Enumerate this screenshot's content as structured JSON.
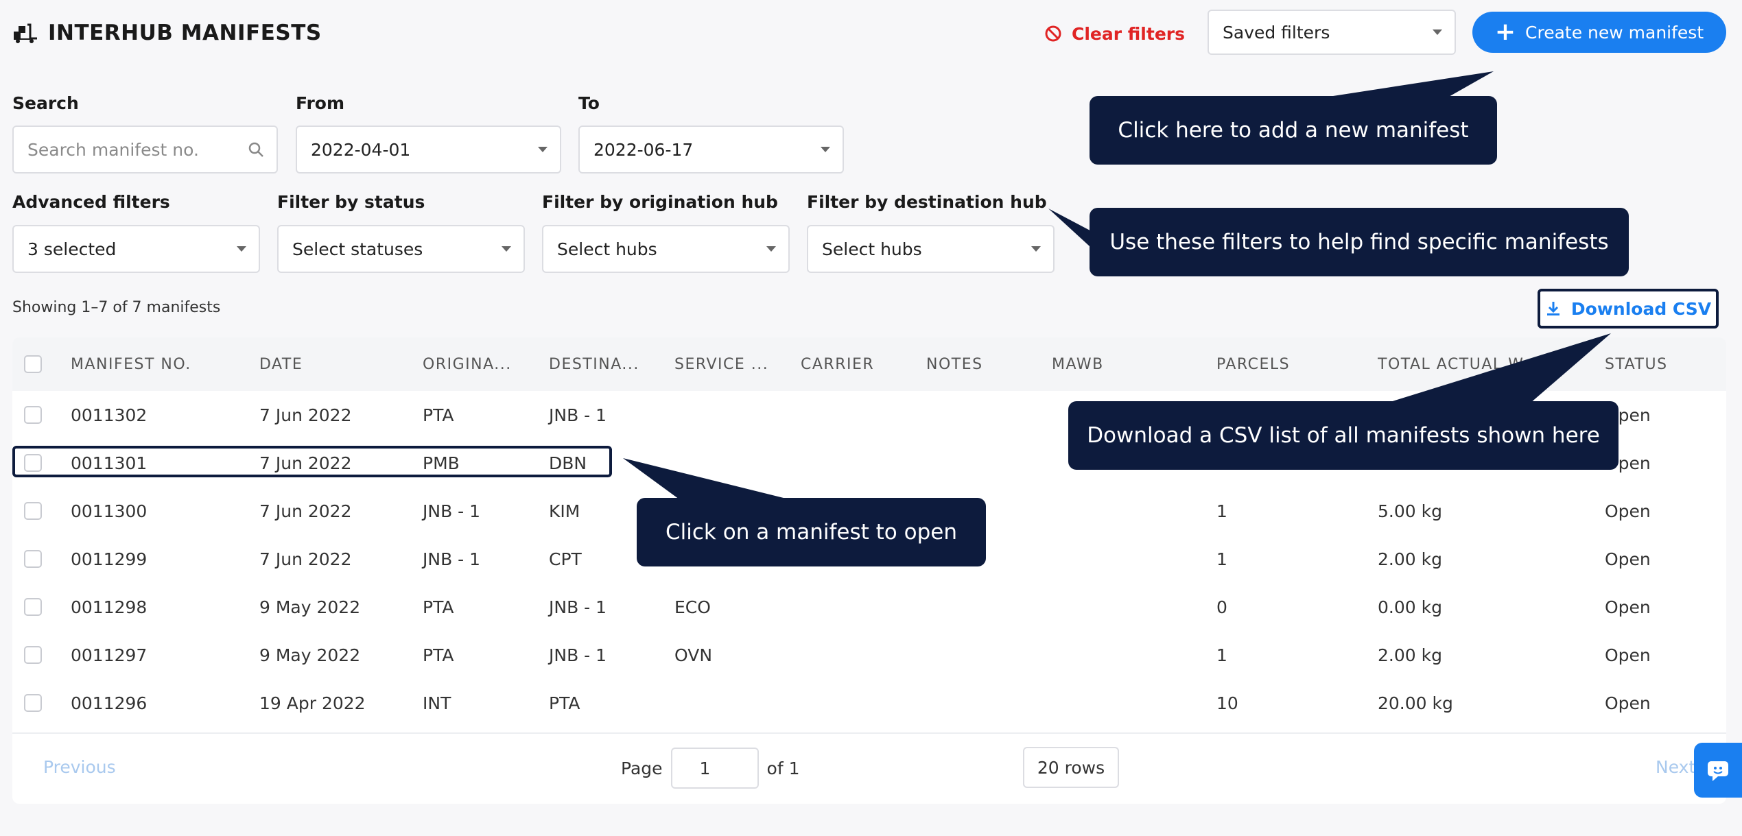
{
  "header": {
    "title": "INTERHUB MANIFESTS",
    "clear_filters": "Clear filters",
    "saved_filters": "Saved filters",
    "create_button": "Create new manifest"
  },
  "filters": {
    "search_label": "Search",
    "search_placeholder": "Search manifest no.",
    "from_label": "From",
    "from_value": "2022-04-01",
    "to_label": "To",
    "to_value": "2022-06-17",
    "advanced_label": "Advanced filters",
    "advanced_value": "3 selected",
    "status_label": "Filter by status",
    "status_value": "Select statuses",
    "origin_label": "Filter by origination hub",
    "origin_value": "Select hubs",
    "destination_label": "Filter by destination hub",
    "destination_value": "Select hubs"
  },
  "summary": "Showing 1–7 of 7 manifests",
  "download_label": "Download CSV",
  "table": {
    "columns": [
      "MANIFEST NO.",
      "DATE",
      "ORIGINA...",
      "DESTINA...",
      "SERVICE ...",
      "CARRIER",
      "NOTES",
      "MAWB",
      "PARCELS",
      "TOTAL ACTUAL W...",
      "STATUS"
    ],
    "rows": [
      {
        "manifest": "0011302",
        "date": "7 Jun 2022",
        "origin": "PTA",
        "destination": "JNB - 1",
        "service": "",
        "parcels": "",
        "weight": "",
        "status": "Open"
      },
      {
        "manifest": "0011301",
        "date": "7 Jun 2022",
        "origin": "PMB",
        "destination": "DBN",
        "service": "",
        "parcels": "",
        "weight": "",
        "status": "Open"
      },
      {
        "manifest": "0011300",
        "date": "7 Jun 2022",
        "origin": "JNB - 1",
        "destination": "KIM",
        "service": "",
        "parcels": "1",
        "weight": "5.00 kg",
        "status": "Open"
      },
      {
        "manifest": "0011299",
        "date": "7 Jun 2022",
        "origin": "JNB - 1",
        "destination": "CPT",
        "service": "",
        "parcels": "1",
        "weight": "2.00 kg",
        "status": "Open"
      },
      {
        "manifest": "0011298",
        "date": "9 May 2022",
        "origin": "PTA",
        "destination": "JNB - 1",
        "service": "ECO",
        "parcels": "0",
        "weight": "0.00 kg",
        "status": "Open"
      },
      {
        "manifest": "0011297",
        "date": "9 May 2022",
        "origin": "PTA",
        "destination": "JNB - 1",
        "service": "OVN",
        "parcels": "1",
        "weight": "2.00 kg",
        "status": "Open"
      },
      {
        "manifest": "0011296",
        "date": "19 Apr 2022",
        "origin": "INT",
        "destination": "PTA",
        "service": "",
        "parcels": "10",
        "weight": "20.00 kg",
        "status": "Open"
      }
    ]
  },
  "pagination": {
    "previous": "Previous",
    "page_label": "Page",
    "page_value": "1",
    "of_label": "of 1",
    "rows": "20 rows",
    "next": "Next"
  },
  "callouts": {
    "create": "Click here to add a new manifest",
    "filters": "Use these filters to help find specific manifests",
    "download": "Download a CSV list of all manifests shown here",
    "open": "Click on a manifest to open"
  },
  "colors": {
    "accent": "#1a7ff0",
    "danger": "#e02424",
    "callout": "#0d1b3d"
  }
}
